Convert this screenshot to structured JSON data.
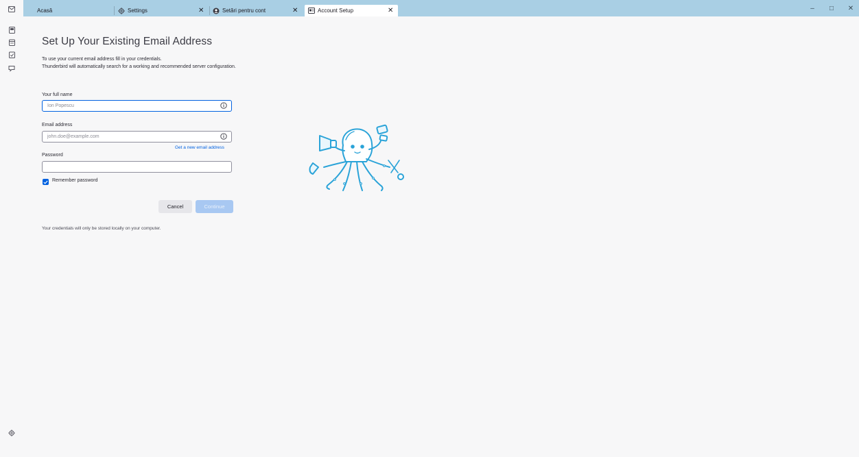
{
  "tabs": [
    {
      "label": "Acasă",
      "icon": "mail-icon"
    },
    {
      "label": "Settings",
      "icon": "gear-icon"
    },
    {
      "label": "Setări pentru cont",
      "icon": "account-settings-icon"
    },
    {
      "label": "Account Setup",
      "icon": "account-setup-icon"
    }
  ],
  "window_controls": {
    "minimize": "–",
    "restore": "□",
    "close": "✕"
  },
  "tab_close_glyph": "✕",
  "spaces": [
    "mail-icon",
    "address-book-icon",
    "calendar-icon",
    "tasks-icon",
    "chat-icon",
    "settings-icon"
  ],
  "page": {
    "title": "Set Up Your Existing Email Address",
    "intro_line1": "To use your current email address fill in your credentials.",
    "intro_line2": "Thunderbird will automatically search for a working and recommended server configuration."
  },
  "form": {
    "name_label": "Your full name",
    "name_placeholder": "Ion Popescu",
    "email_label": "Email address",
    "email_placeholder": "john.doe@example.com",
    "get_new_email": "Get a new email address",
    "password_label": "Password",
    "password_value": "",
    "remember_label": "Remember password",
    "remember_checked": true
  },
  "buttons": {
    "cancel": "Cancel",
    "continue": "Continue"
  },
  "footnote": "Your credentials will only be stored locally on your computer.",
  "colors": {
    "accent": "#0061e0",
    "tabbar": "#a9cfe4",
    "mascot": "#2aa3d8",
    "background": "#f7f7f8"
  }
}
